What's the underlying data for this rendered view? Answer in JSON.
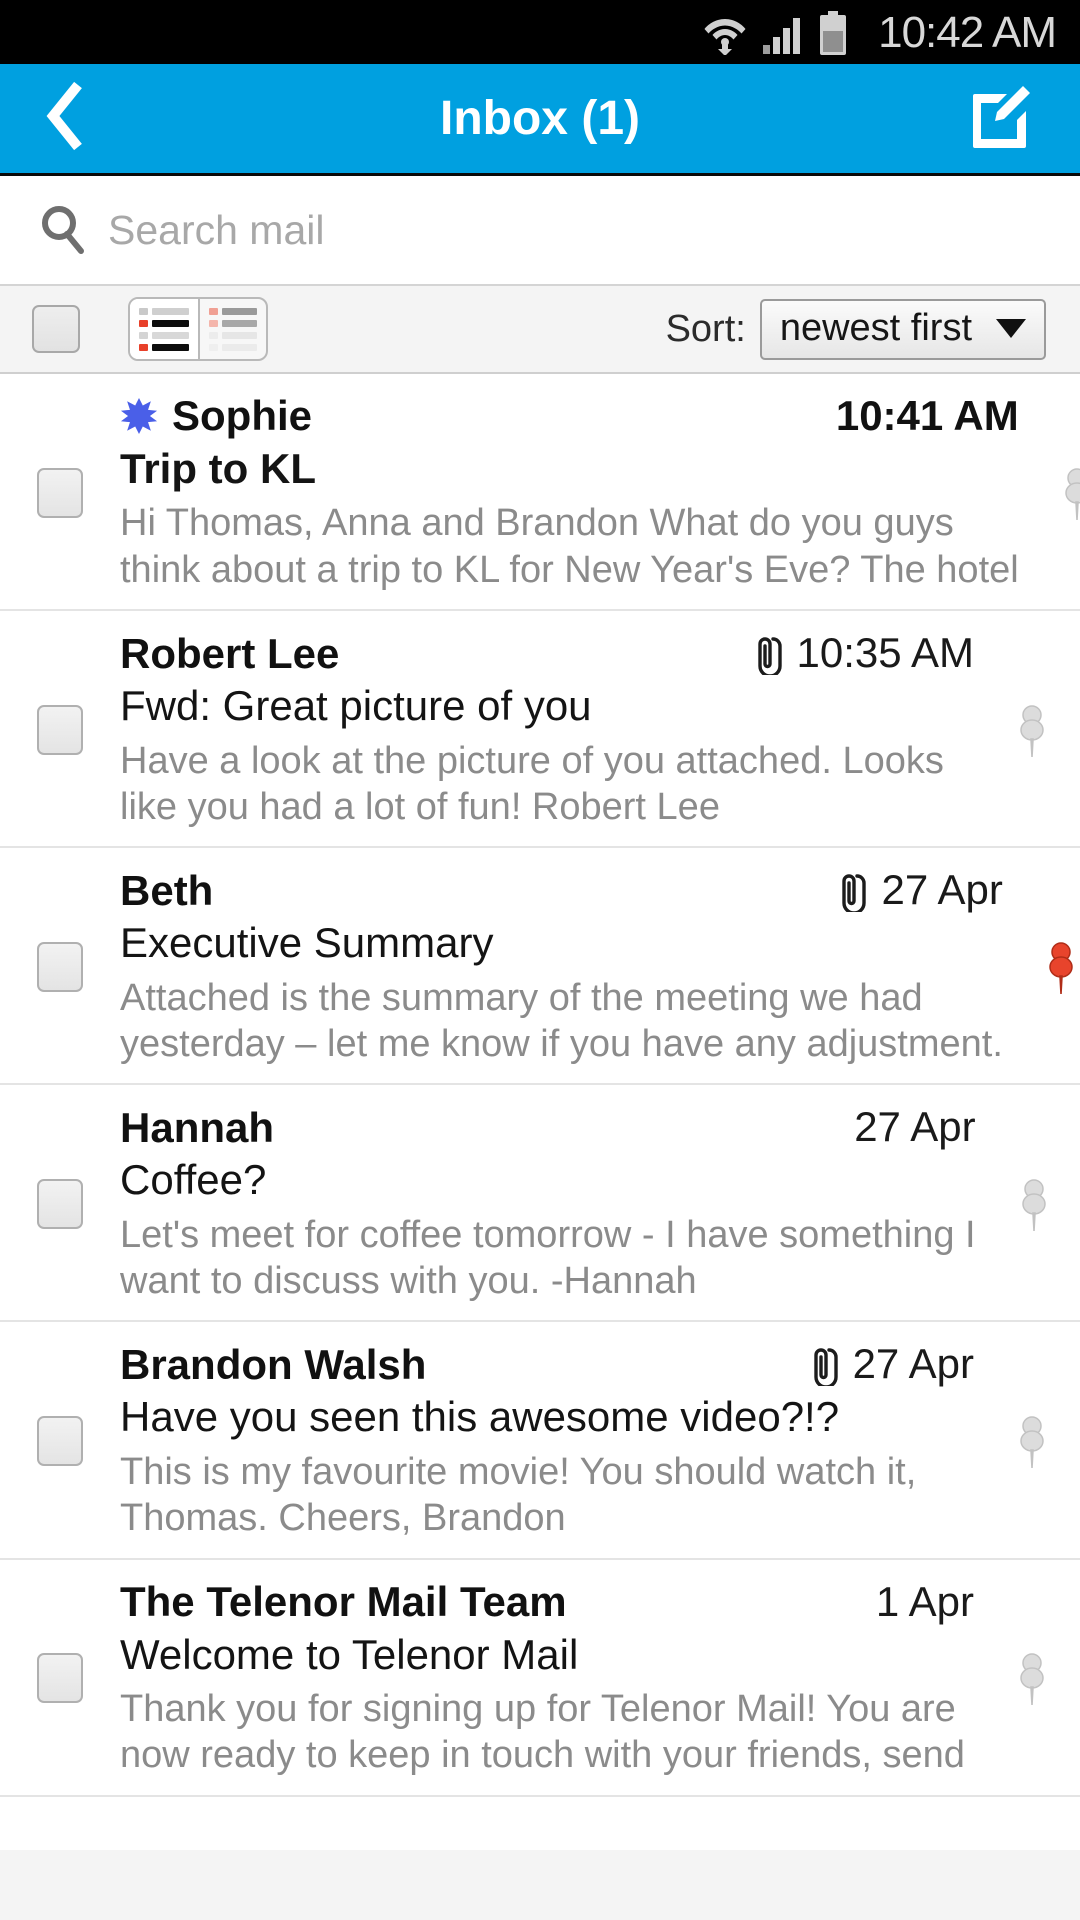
{
  "statusbar": {
    "time": "10:42 AM",
    "icons": [
      "wifi-icon",
      "signal-icon",
      "battery-icon"
    ]
  },
  "appbar": {
    "title": "Inbox (1)",
    "back_icon": "back-chevron-icon",
    "compose_icon": "compose-icon",
    "accent_color": "#00a0e0"
  },
  "search": {
    "placeholder": "Search mail",
    "value": "",
    "icon": "search-icon"
  },
  "toolbar": {
    "select_all_checkbox": "",
    "view_toggle": {
      "compact_label": "compact-view",
      "comfortable_label": "comfortable-view",
      "active": "compact-view"
    },
    "sort_label": "Sort:",
    "sort_value": "newest first",
    "sort_caret": "chevron-down-icon",
    "sort_options": [
      "newest first"
    ]
  },
  "mail": {
    "rows": [
      {
        "sender": "Sophie",
        "date": "10:41 AM",
        "subject": "Trip to KL",
        "preview_line1": "Hi Thomas, Anna and Brandon What do you guys",
        "preview_line2": "think about a trip to KL for New Year's Eve? The hotel",
        "unread": true,
        "attachment": false,
        "pin": "grey"
      },
      {
        "sender": "Robert Lee",
        "date": "10:35 AM",
        "subject": "Fwd: Great picture of you",
        "preview_line1": "Have a look at the picture of you attached. Looks",
        "preview_line2": "like you had a lot of fun! Robert Lee",
        "unread": false,
        "attachment": true,
        "pin": "grey"
      },
      {
        "sender": "Beth",
        "date": "27 Apr",
        "subject": "Executive Summary",
        "preview_line1": "Attached is the summary of the meeting we had",
        "preview_line2": "yesterday – let me know if you have any adjustment.",
        "unread": false,
        "attachment": true,
        "pin": "red"
      },
      {
        "sender": "Hannah",
        "date": "27 Apr",
        "subject": "Coffee?",
        "preview_line1": "Let's meet for coffee tomorrow - I have something I",
        "preview_line2": "want to discuss with you. -Hannah",
        "unread": false,
        "attachment": false,
        "pin": "grey"
      },
      {
        "sender": "Brandon Walsh",
        "date": "27 Apr",
        "subject": "Have you seen this awesome video?!?",
        "preview_line1": "This is my favourite movie! You should watch it,",
        "preview_line2": "Thomas. Cheers, Brandon",
        "unread": false,
        "attachment": true,
        "pin": "grey"
      },
      {
        "sender": "The Telenor Mail Team",
        "date": "1 Apr",
        "subject": "Welcome to Telenor Mail",
        "preview_line1": "Thank you for signing up for Telenor Mail! You are",
        "preview_line2": "now ready to keep in touch with your friends, send",
        "unread": false,
        "attachment": false,
        "pin": "grey"
      }
    ]
  },
  "colors": {
    "accent": "#00a0e0",
    "unread_star": "#4a5fe8",
    "pin_red": "#e8442c",
    "preview_text": "#8b8b8b"
  }
}
